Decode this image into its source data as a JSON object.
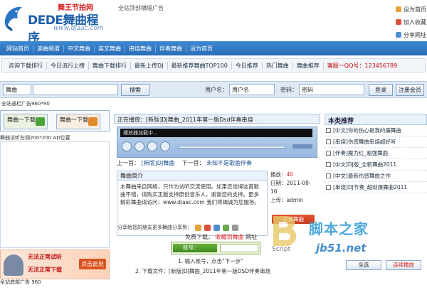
{
  "header": {
    "brand": "DEDE舞曲程序",
    "slogan": "舞王节拍网",
    "url": "www.djaac.com",
    "top_ad": "全站顶部横幅广告",
    "links": [
      {
        "label": "设为首页",
        "color": "#e9a23b"
      },
      {
        "label": "加入收藏",
        "color": "#d9533b"
      },
      {
        "label": "分享网址",
        "color": "#4f8fd1"
      }
    ]
  },
  "mainnav": [
    "网站首页",
    "迪曲频道",
    "中文舞曲",
    "英文舞曲",
    "串烧舞曲",
    "伴奏舞曲",
    "设为首页"
  ],
  "subnav": [
    {
      "label": "咨询下载排行",
      "hot": false
    },
    {
      "label": "今日流行上榜",
      "hot": false
    },
    {
      "label": "舞曲下载排行",
      "hot": false
    },
    {
      "label": "最新上传DJ",
      "hot": false
    },
    {
      "label": "最新推荐舞曲TOP100",
      "hot": false
    },
    {
      "label": "今日推荐",
      "hot": false
    },
    {
      "label": "热门舞曲",
      "hot": false
    },
    {
      "label": "舞曲推荐",
      "hot": false
    },
    {
      "label": "客服一QQ号：123456789",
      "hot": true
    }
  ],
  "search": {
    "category": "舞曲",
    "query": "",
    "button": "搜索",
    "user_label": "用户名：",
    "user_value": "用户名",
    "pass_label": "密码：",
    "pass_value": "密码",
    "login": "登录",
    "register": "注册会员"
  },
  "ad_under_search": "全站通栏广告960*90",
  "left": {
    "tab1": "舞曲一下载",
    "tab2": "舞曲一下载",
    "ad_label": "舞曲试听左侧200*200 AD位置",
    "banner_line1": "无法正常试听",
    "banner_line2": "无法正常下载",
    "banner_cta": "点击此处"
  },
  "player": {
    "title": "正在播放：[新版]DJ舞曲_2011年第一版Dsd伴奏串烧",
    "screen": "播放器加载中...",
    "nav_prev_label": "上一首：",
    "nav_prev": "[新版]DJ舞曲",
    "nav_next_label": "下一首：",
    "nav_next": "未知不是歌曲伴奏"
  },
  "intro": {
    "heading": "舞曲简介",
    "body": "本舞曲来自网络，只作为试听交流使用。如果您觉得这首歌曲不错，请购买正版支持原创音乐人，谢谢您的支持。更多精彩舞曲请访问：www.djaac.com 我们将竭诚为您服务。",
    "share_label": "分享给您的朋友更多舞曲分享到："
  },
  "songinfo": {
    "plays_label": "播放：",
    "plays": "40",
    "date_label": "日期：",
    "date": "2011-08-16",
    "uploader_label": "上传：",
    "uploader": "admin",
    "favorite": "收藏舞曲"
  },
  "download": {
    "line_a": "免费下载，",
    "line_b": "收藏到舞曲",
    "line_c": "网址",
    "field_label": "账号：",
    "step1": "1. 输入账号，点击“下一步”",
    "step2": "2. 下载文件：[新版]DJ舞曲_2011年第一版DSD伴奏串烧"
  },
  "watermark": {
    "cn": "脚本之家",
    "url": "jb51.net",
    "script": "Script"
  },
  "right": {
    "heading": "本类推荐",
    "items": [
      "[中文]你的伤心是我的痛舞曲",
      "[串烧]伤感舞曲串烧超好听",
      "[伴奏]魔力红_超强舞曲",
      "[中文]DJ版_全新舞曲2011",
      "[中文]最新伤感舞曲之作",
      "[串烧]DJ节奏_超劲爆舞曲2011"
    ],
    "btn_all": "全选",
    "btn_play": "连续播放"
  },
  "footer_ad": "全站底部广告 960"
}
